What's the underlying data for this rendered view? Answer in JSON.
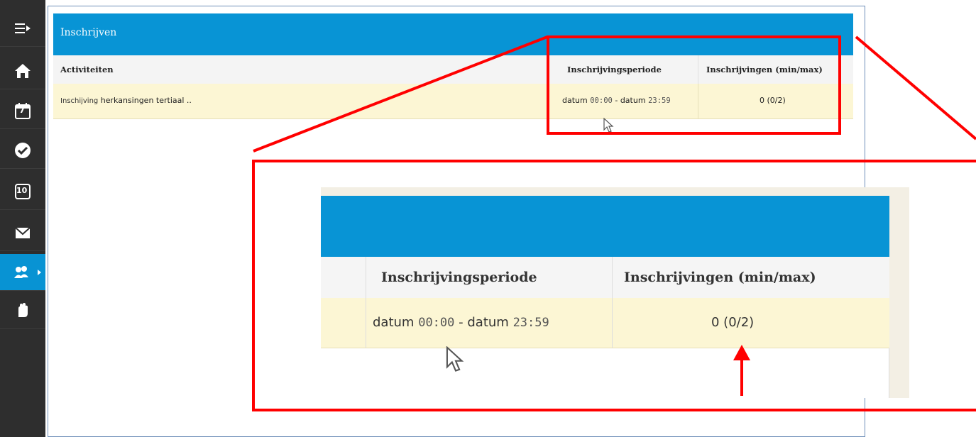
{
  "sidebar": {
    "items": [
      {
        "icon": "menu-toggle-icon"
      },
      {
        "icon": "home-icon"
      },
      {
        "icon": "calendar-icon",
        "label": "7"
      },
      {
        "icon": "check-icon"
      },
      {
        "icon": "grades-icon",
        "label": "10"
      },
      {
        "icon": "mail-icon"
      },
      {
        "icon": "people-icon",
        "active": true
      },
      {
        "icon": "hand-icon"
      }
    ]
  },
  "header": {
    "title": "Inschrijven"
  },
  "table": {
    "headers": [
      "Activiteiten",
      "Inschrijvingsperiode",
      "Inschrijvingen (min/max)"
    ],
    "row": {
      "activity_prefix": "Inschijving",
      "activity_name": "herkansingen tertiaal ..",
      "period_start_label": "datum",
      "period_start_time": "00:00",
      "period_sep": "-",
      "period_end_label": "datum",
      "period_end_time": "23:59",
      "count": "0 (0/2)"
    }
  },
  "colors": {
    "accent": "#0894d5",
    "highlight": "#ff0000",
    "row_bg": "#fcf6d4",
    "sidebar": "#2e2e2e"
  }
}
